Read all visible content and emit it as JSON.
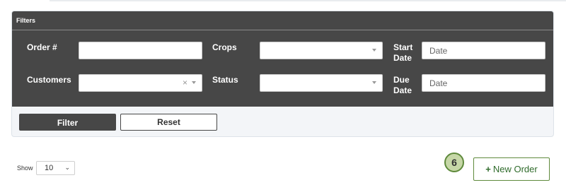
{
  "filters": {
    "title": "Filters",
    "order_label": "Order #",
    "crops_label": "Crops",
    "start_date_label_line1": "Start",
    "start_date_label_line2": "Date",
    "customers_label": "Customers",
    "status_label": "Status",
    "due_date_label_line1": "Due",
    "due_date_label_line2": "Date",
    "start_date_placeholder": "Date",
    "due_date_placeholder": "Date",
    "customers_clear": "×",
    "filter_button": "Filter",
    "reset_button": "Reset"
  },
  "show": {
    "label": "Show",
    "value": "10",
    "chevron": "⌄"
  },
  "badge": "6",
  "new_order": {
    "plus": "+",
    "label": "New Order"
  }
}
